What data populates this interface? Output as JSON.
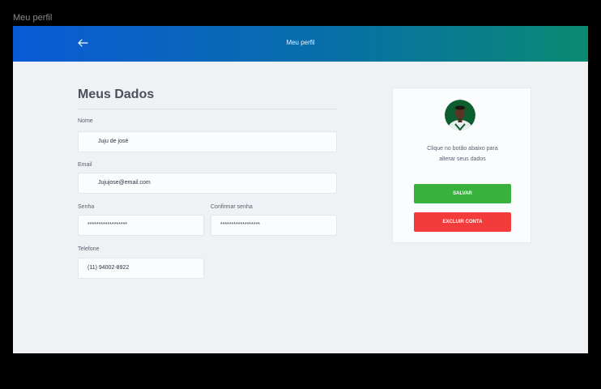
{
  "frame_label": "Meu perfil",
  "header": {
    "title": "Meu perfil",
    "back_icon": "arrow-left-icon"
  },
  "form": {
    "title": "Meus Dados",
    "fields": {
      "nome": {
        "label": "Nome",
        "value": "Juju de josé"
      },
      "email": {
        "label": "Email",
        "value": "Jujujose@email.com"
      },
      "senha": {
        "label": "Senha",
        "value": "******************"
      },
      "confirmar_senha": {
        "label": "Confirmar senha",
        "value": "******************"
      },
      "telefone": {
        "label": "Telefone",
        "value": "(11) 94002-8922"
      }
    }
  },
  "card": {
    "avatar_icon": "user-avatar",
    "message_line1": "Clique no botão abaixo para",
    "message_line2": "alterar seus dados",
    "save_label": "SALVAR",
    "delete_label": "EXCLUIR CONTA"
  },
  "colors": {
    "header_gradient_start": "#0a5ad6",
    "header_gradient_end": "#0a8a72",
    "save": "#38b23c",
    "delete": "#f23b3b",
    "background": "#f0f1f4"
  }
}
